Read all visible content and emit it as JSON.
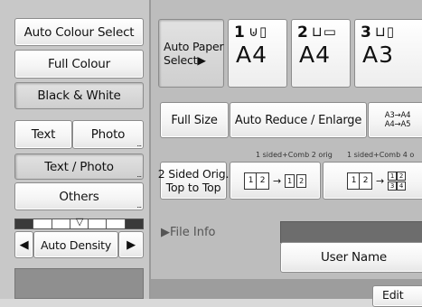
{
  "colour": {
    "auto_colour_select": "Auto Colour Select",
    "full_colour": "Full Colour",
    "black_white": "Black & White"
  },
  "image_mode": {
    "text": "Text",
    "photo": "Photo",
    "text_photo": "Text / Photo",
    "others": "Others"
  },
  "density": {
    "auto_density": "Auto Density",
    "left_arrow": "◀",
    "right_arrow": "▶"
  },
  "paper": {
    "auto_paper_select_line1": "Auto Paper",
    "auto_paper_select_line2": "Select▶",
    "trays": [
      {
        "number": "1",
        "size": "A4"
      },
      {
        "number": "2",
        "size": "A4"
      },
      {
        "number": "3",
        "size": "A3"
      }
    ]
  },
  "reduce": {
    "full_size": "Full Size",
    "auto_reduce_enlarge": "Auto Reduce / Enlarge",
    "preset_line1": "A3→A4",
    "preset_line2": "A4→A5"
  },
  "duplex": {
    "caption_1": "1 sided+Comb 2 orig",
    "caption_2": "1 sided+Comb 4 o",
    "two_sided_line1": "2 Sided Orig.",
    "two_sided_line2": "Top to Top"
  },
  "file_info": {
    "label": "▶File Info",
    "user_name": "User Name",
    "edit": "Edit"
  },
  "colors": {
    "background": "#bdbdbd",
    "button": "#f4f4f4",
    "selected": "#d6d6d6",
    "dark_bar": "#7a7a7a"
  }
}
